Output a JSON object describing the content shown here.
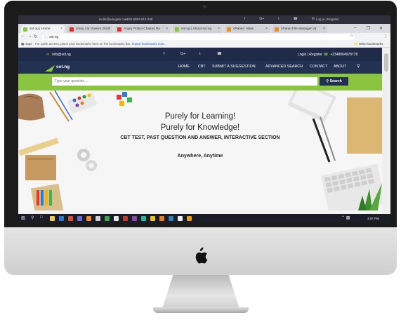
{
  "os_topbar": {
    "email": "Hello@edugate.com",
    "phone": "+234 8097-612-345",
    "social_icons": [
      "facebook-icon",
      "google-plus-icon",
      "twitter-icon",
      "whatsapp-icon",
      "email-icon"
    ],
    "auth_label": "Log in  |  Register"
  },
  "browser": {
    "tabs": [
      {
        "label": "sol.ng | Home",
        "active": true,
        "favicon_color": "#8bc540"
      },
      {
        "label": "crazy car chases 2016",
        "active": false,
        "favicon_color": "#e02b2b"
      },
      {
        "label": "Angry Police Chases Ru",
        "active": false,
        "favicon_color": "#e02b2b"
      },
      {
        "label": "sol.ng | About sol.ng",
        "active": false,
        "favicon_color": "#8bc540"
      },
      {
        "label": "cPanel - Main",
        "active": false,
        "favicon_color": "#f08a24"
      },
      {
        "label": "cPanel File Manager v3",
        "active": false,
        "favicon_color": "#f08a24"
      }
    ],
    "address": "sol.ng",
    "bookmarks": {
      "apps_label": "Apps",
      "hint_text": "For quick access, place your bookmarks here on the bookmarks bar.",
      "import_link": "Import bookmarks now...",
      "other_label": "Other bookmarks"
    }
  },
  "site": {
    "topbar": {
      "email": "info@sol.ng",
      "login": "Login  |  Register",
      "phone": "+2348064978778"
    },
    "logo_text": "sol.ng",
    "nav": [
      "HOME",
      "CBT",
      "SUBMIT A SUGGESTION",
      "ADVANCED SEARCH",
      "CONTACT",
      "ABOUT"
    ],
    "search": {
      "placeholder": "Type your question....",
      "button_label": "Search"
    },
    "hero": {
      "line1": "Purely for Learning!",
      "line2": "Purely for Knowledge!",
      "line3": "CBT TEST, PAST QUESTION AND ANSWER, INTERACTIVE SECTION",
      "line4": "Anywhere, Anytime"
    },
    "colors": {
      "navy": "#1f2b48",
      "green": "#8bc540"
    }
  },
  "taskbar": {
    "time": "3:57 PM"
  }
}
